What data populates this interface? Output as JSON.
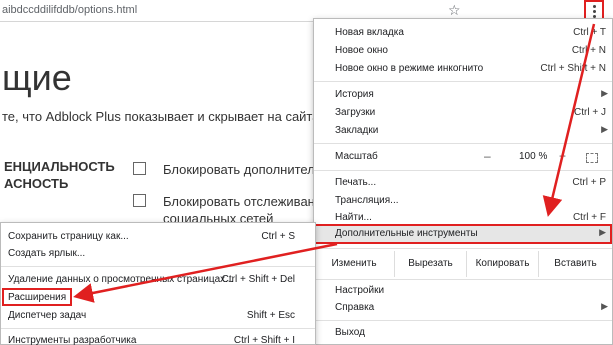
{
  "browser": {
    "url": "aibdccddilifddb/options.html",
    "star_icon": "☆"
  },
  "page": {
    "heading": "щие",
    "description": "те, что Adblock Plus показывает и скрывает на сайтах",
    "section_title_1": "ЕНЦИАЛЬНОСТЬ",
    "section_title_2": "АСНОСТЬ",
    "option1": "Блокировать дополнительн",
    "option2_line1": "Блокировать отслеживани",
    "option2_line2": "социальных сетей"
  },
  "menu": {
    "new_tab": "Новая вкладка",
    "new_tab_sc": "Ctrl + T",
    "new_window": "Новое окно",
    "new_window_sc": "Ctrl + N",
    "incognito": "Новое окно в режиме инкогнито",
    "incognito_sc": "Ctrl + Shift + N",
    "history": "История",
    "downloads": "Загрузки",
    "downloads_sc": "Ctrl + J",
    "bookmarks": "Закладки",
    "zoom": "Масштаб",
    "zoom_minus": "–",
    "zoom_value": "100 %",
    "zoom_plus": "+",
    "print": "Печать...",
    "print_sc": "Ctrl + P",
    "cast": "Трансляция...",
    "find": "Найти...",
    "find_sc": "Ctrl + F",
    "more_tools": "Дополнительные инструменты",
    "edit": "Изменить",
    "cut": "Вырезать",
    "copy": "Копировать",
    "paste": "Вставить",
    "settings": "Настройки",
    "help": "Справка",
    "exit": "Выход"
  },
  "submenu": {
    "save_page": "Сохранить страницу как...",
    "save_page_sc": "Ctrl + S",
    "create_shortcut": "Создать ярлык...",
    "clear_data": "Удаление данных о просмотренных страницах...",
    "clear_data_sc": "Ctrl + Shift + Del",
    "extensions": "Расширения",
    "task_manager": "Диспетчер задач",
    "task_manager_sc": "Shift + Esc",
    "dev_tools": "Инструменты разработчика",
    "dev_tools_sc": "Ctrl + Shift + I"
  },
  "colors": {
    "highlight": "#e02020"
  }
}
